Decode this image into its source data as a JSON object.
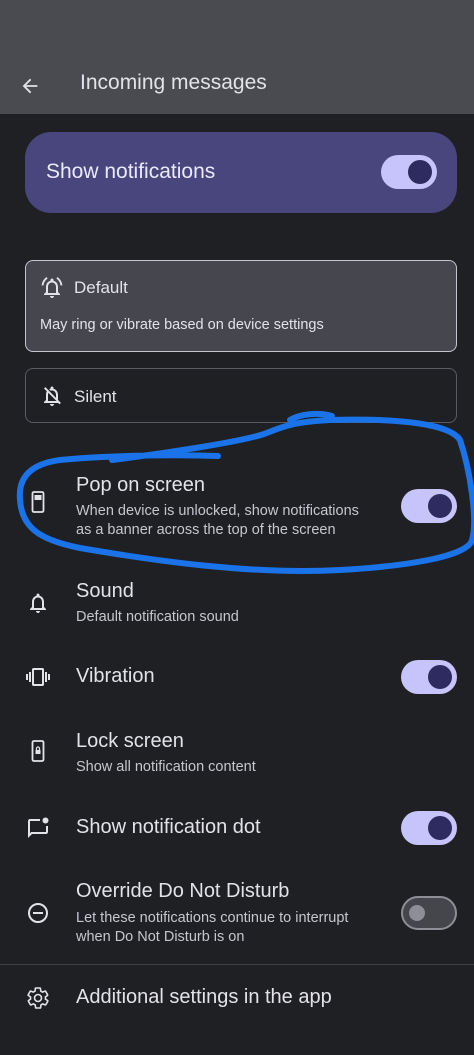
{
  "header": {
    "title": "Incoming messages"
  },
  "master_toggle": {
    "label": "Show notifications",
    "on": true
  },
  "options": {
    "default": {
      "title": "Default",
      "description": "May ring or vibrate based on device settings",
      "selected": true
    },
    "silent": {
      "title": "Silent",
      "selected": false
    }
  },
  "settings": {
    "pop": {
      "title": "Pop on screen",
      "subtitle_line1": "When device is unlocked, show notifications",
      "subtitle_line2": "as a banner across the top of the screen",
      "on": true
    },
    "sound": {
      "title": "Sound",
      "subtitle": "Default notification sound"
    },
    "vibration": {
      "title": "Vibration",
      "on": true
    },
    "lock": {
      "title": "Lock screen",
      "subtitle": "Show all notification content"
    },
    "dot": {
      "title": "Show notification dot",
      "on": true
    },
    "dnd": {
      "title": "Override Do Not Disturb",
      "subtitle_line1": "Let these notifications continue to interrupt",
      "subtitle_line2": "when Do Not Disturb is on",
      "on": false
    },
    "additional": {
      "title": "Additional settings in the app"
    }
  },
  "colors": {
    "accent_track": "#c7c3fb",
    "accent_thumb": "#2e2b60",
    "master_card": "#48467c",
    "annotation": "#1a73e8"
  },
  "icons": [
    "back-arrow-icon",
    "bell-icon",
    "bell-off-icon",
    "phone-banner-icon",
    "bell-icon",
    "vibration-icon",
    "lock-phone-icon",
    "chat-dot-icon",
    "dnd-minus-icon",
    "gear-icon"
  ]
}
